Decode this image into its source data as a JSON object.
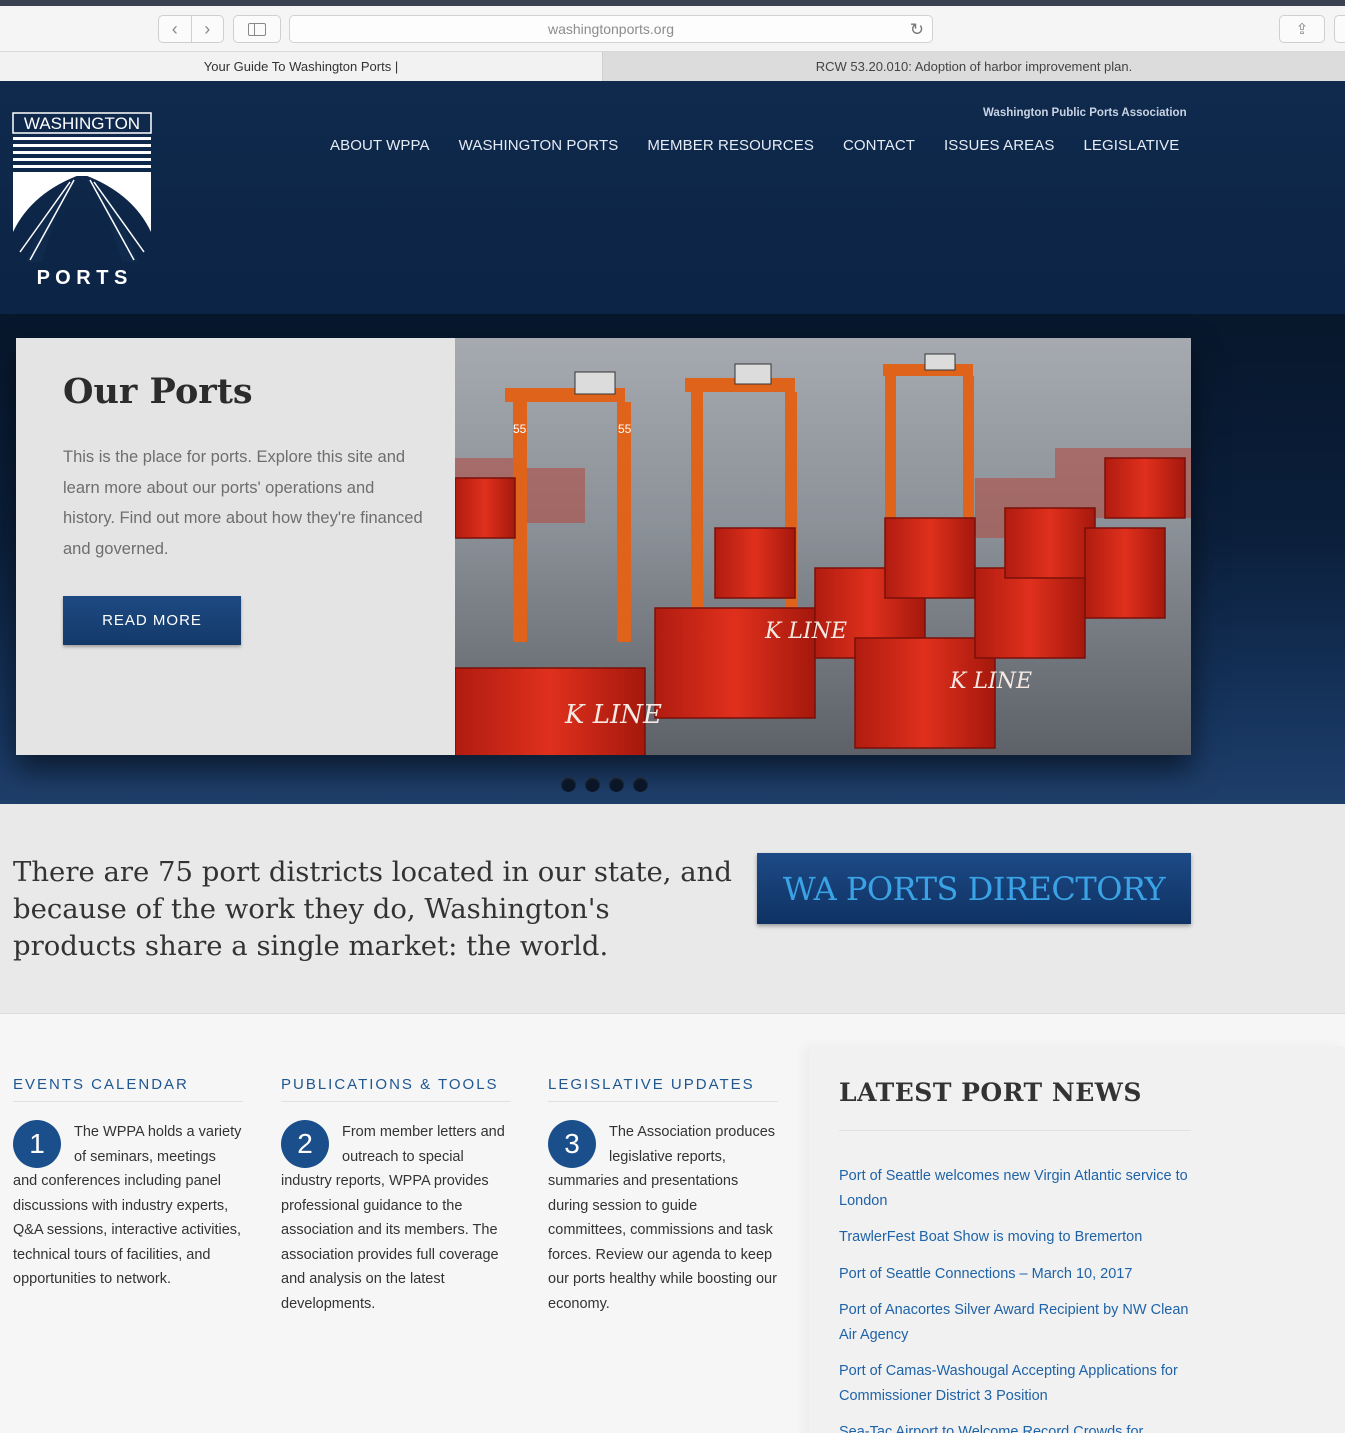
{
  "browser": {
    "url": "washingtonports.org",
    "tabs": [
      {
        "label": "Your Guide To Washington Ports |"
      },
      {
        "label": "RCW 53.20.010: Adoption of harbor improvement plan."
      }
    ]
  },
  "header": {
    "logo_top": "WASHINGTON",
    "logo_bottom": "P O R T S",
    "association": "Washington Public Ports Association",
    "nav": [
      "ABOUT WPPA",
      "WASHINGTON PORTS",
      "MEMBER RESOURCES",
      "CONTACT",
      "ISSUES AREAS",
      "LEGISLATIVE"
    ]
  },
  "hero": {
    "title": "Our Ports",
    "body": "This is the place for ports. Explore this site and learn more about our ports' operations and history. Find out more about how they're financed and governed.",
    "button": "READ MORE",
    "photo_labels": [
      "K LINE",
      "K LINE",
      "K LINE",
      "55",
      "55"
    ],
    "slide_count": 4
  },
  "intro": {
    "text": "There are 75 port districts located in our state, and because of the work they do, Washington's products share a single market: the world.",
    "directory_button": "WA PORTS DIRECTORY"
  },
  "columns": [
    {
      "heading": "EVENTS CALENDAR",
      "number": "1",
      "body": "The WPPA holds a variety of seminars, meetings and conferences including panel discussions with industry experts, Q&A sessions, interactive activities, technical tours of facilities, and opportunities to network."
    },
    {
      "heading": "PUBLICATIONS & TOOLS",
      "number": "2",
      "body": "From member letters and outreach to special industry reports, WPPA provides professional guidance to the association and its members. The association provides full coverage and analysis on the latest developments."
    },
    {
      "heading": "LEGISLATIVE UPDATES",
      "number": "3",
      "body": "The Association produces legislative reports, summaries and presentations during session to guide committees, commissions and task forces. Review our agenda to keep our ports healthy while boosting our economy."
    }
  ],
  "news": {
    "title": "LATEST PORT NEWS",
    "items": [
      "Port of Seattle welcomes new Virgin Atlantic service to London",
      "TrawlerFest Boat Show is moving to Bremerton",
      "Port of Seattle Connections – March 10, 2017",
      "Port of Anacortes Silver Award Recipient by NW Clean Air Agency",
      "Port of Camas-Washougal Accepting Applications for Commissioner District 3 Position",
      "Sea-Tac Airport to Welcome Record Crowds for"
    ]
  },
  "colors": {
    "header_navy": "#0f2a4d",
    "accent_blue": "#1a4f8c",
    "link_blue": "#1e63a8",
    "directory_text": "#3aa3e6"
  }
}
